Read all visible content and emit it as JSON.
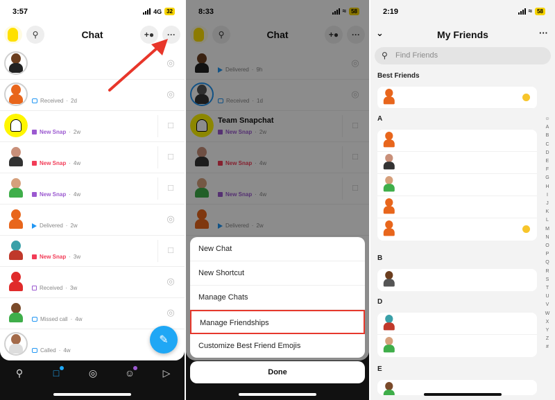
{
  "panel1": {
    "status": {
      "time": "3:57",
      "network": "4G",
      "battery": "32"
    },
    "header": {
      "title": "Chat",
      "add_icon": "add-friend-icon",
      "more_icon": "more-icon",
      "search_icon": "search-icon"
    },
    "rows": [
      {
        "name": "",
        "status": "",
        "time": "",
        "kind": "none"
      },
      {
        "name": "",
        "status": "Received",
        "time": "2d",
        "kind": "received-chat"
      },
      {
        "name": "",
        "status": "New Snap",
        "time": "2w",
        "kind": "new-snap-purple"
      },
      {
        "name": "",
        "status": "New Snap",
        "time": "4w",
        "kind": "new-snap-red"
      },
      {
        "name": "",
        "status": "New Snap",
        "time": "4w",
        "kind": "new-snap-purple"
      },
      {
        "name": "",
        "status": "Delivered",
        "time": "2w",
        "kind": "delivered"
      },
      {
        "name": "",
        "status": "New Snap",
        "time": "3w",
        "kind": "new-snap-red"
      },
      {
        "name": "",
        "status": "Received",
        "time": "3w",
        "kind": "received-snap"
      },
      {
        "name": "",
        "status": "Missed call",
        "time": "4w",
        "kind": "missed-call"
      },
      {
        "name": "",
        "status": "Called",
        "time": "4w",
        "kind": "called"
      }
    ],
    "fab_icon": "new-chat-icon"
  },
  "panel2": {
    "status": {
      "time": "8:33",
      "battery": "58"
    },
    "header": {
      "title": "Chat"
    },
    "rows": [
      {
        "name": "",
        "status": "Delivered",
        "time": "9h"
      },
      {
        "name": "",
        "status": "Received",
        "time": "1d"
      },
      {
        "name": "Team Snapchat",
        "status": "New Snap",
        "time": "2w"
      },
      {
        "name": "",
        "status": "New Snap",
        "time": "4w"
      },
      {
        "name": "",
        "status": "New Snap",
        "time": "4w"
      },
      {
        "name": "",
        "status": "Delivered",
        "time": "2w"
      }
    ],
    "menu": [
      "New Chat",
      "New Shortcut",
      "Manage Chats",
      "Manage Friendships",
      "Customize Best Friend Emojis"
    ],
    "highlighted_item": "Manage Friendships",
    "done_label": "Done"
  },
  "panel3": {
    "status": {
      "time": "2:19",
      "battery": "58"
    },
    "header": {
      "title": "My Friends"
    },
    "search": {
      "placeholder": "Find Friends"
    },
    "sections": [
      {
        "title": "Best Friends",
        "count": 1
      },
      {
        "title": "A",
        "count": 5
      },
      {
        "title": "B",
        "count": 1
      },
      {
        "title": "D",
        "count": 2
      },
      {
        "title": "E",
        "count": 1
      }
    ],
    "alphabet": [
      "☺",
      "A",
      "B",
      "C",
      "D",
      "E",
      "F",
      "G",
      "H",
      "I",
      "J",
      "K",
      "L",
      "M",
      "N",
      "O",
      "P",
      "Q",
      "R",
      "S",
      "T",
      "U",
      "V",
      "W",
      "X",
      "Y",
      "Z",
      "#"
    ]
  },
  "colors": {
    "snap_purple": "#9b59d0",
    "snap_red": "#f23c57",
    "chat_blue": "#2196f3",
    "fab_blue": "#1fa7f5",
    "highlight_red": "#e6382c",
    "snap_yellow": "#fff600"
  }
}
